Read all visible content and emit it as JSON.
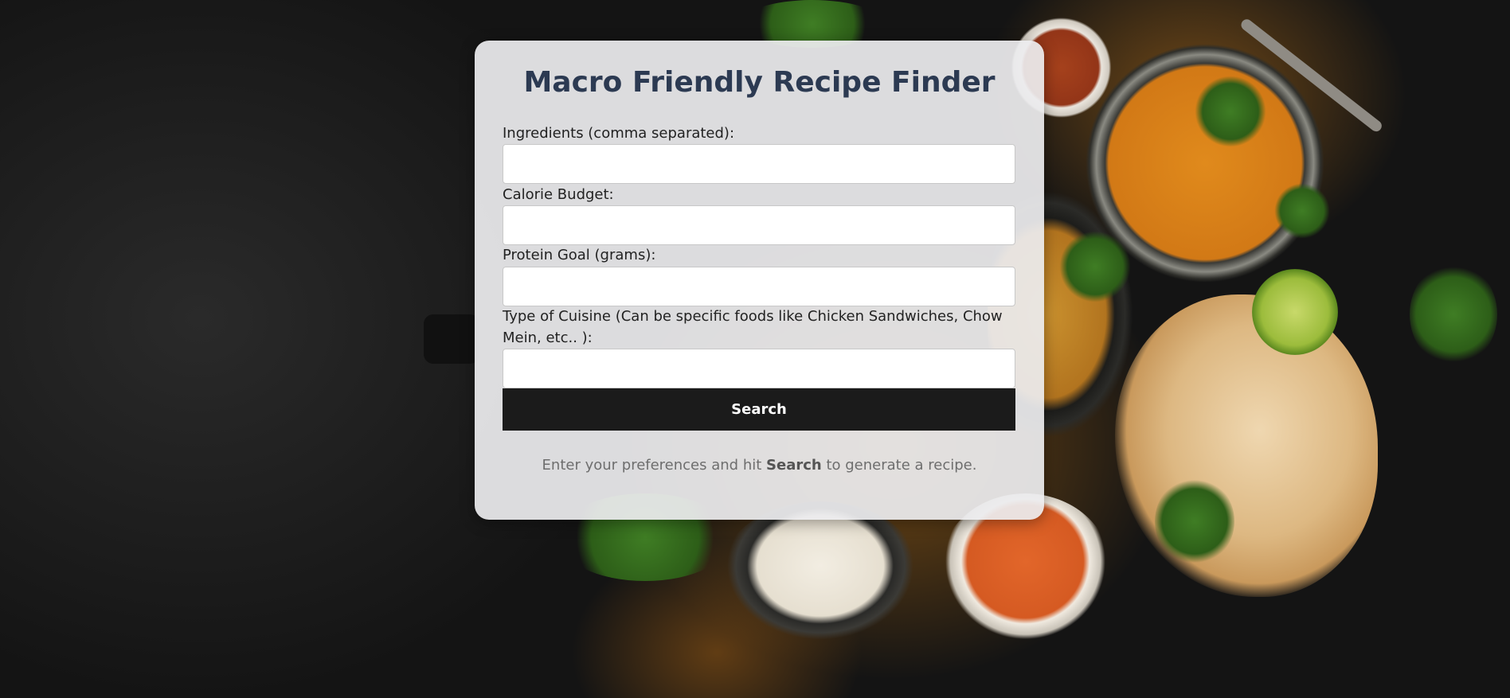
{
  "page": {
    "title": "Macro Friendly Recipe Finder"
  },
  "form": {
    "ingredients_label": "Ingredients (comma separated):",
    "ingredients_value": "",
    "calories_label": "Calorie Budget:",
    "calories_value": "",
    "protein_label": "Protein Goal (grams):",
    "protein_value": "",
    "cuisine_label": "Type of Cuisine (Can be specific foods like Chicken Sandwiches, Chow Mein, etc.. ):",
    "cuisine_value": "",
    "search_label": "Search"
  },
  "hint": {
    "before": "Enter your preferences and hit",
    "emphasis": "Search",
    "after": "to generate a recipe."
  },
  "colors": {
    "title": "#2c3a52",
    "button_bg": "#1b1b1b",
    "card_bg": "#ececee"
  }
}
